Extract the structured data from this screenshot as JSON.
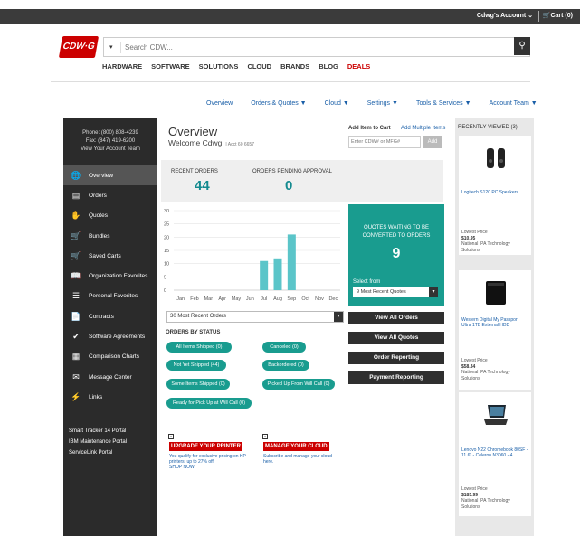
{
  "topbar": {
    "account": "Cdwg's Account",
    "cart": "Cart (0)"
  },
  "header": {
    "logo": "CDW·G",
    "search_placeholder": "Search CDW...",
    "nav": [
      "HARDWARE",
      "SOFTWARE",
      "SOLUTIONS",
      "CLOUD",
      "BRANDS",
      "BLOG"
    ],
    "nav_deals": "DEALS"
  },
  "subnav": [
    "Overview",
    "Orders & Quotes ▼",
    "Cloud ▼",
    "Settings ▼",
    "Tools & Services ▼",
    "Account Team ▼"
  ],
  "sidebar": {
    "phone": "Phone: (800) 808-4239",
    "fax": "Fax: (847) 419-6200",
    "team": "View Your Account Team",
    "items": [
      {
        "label": "Overview",
        "icon": "globe-icon",
        "glyph": "🌐"
      },
      {
        "label": "Orders",
        "icon": "box-icon",
        "glyph": "▤"
      },
      {
        "label": "Quotes",
        "icon": "handshake-icon",
        "glyph": "✋"
      },
      {
        "label": "Bundles",
        "icon": "cart-icon",
        "glyph": "🛒"
      },
      {
        "label": "Saved Carts",
        "icon": "saved-cart-icon",
        "glyph": "🛒"
      },
      {
        "label": "Organization Favorites",
        "icon": "book-icon",
        "glyph": "📖"
      },
      {
        "label": "Personal Favorites",
        "icon": "list-icon",
        "glyph": "☰"
      },
      {
        "label": "Contracts",
        "icon": "document-icon",
        "glyph": "📄"
      },
      {
        "label": "Software Agreements",
        "icon": "check-circle-icon",
        "glyph": "✔"
      },
      {
        "label": "Comparison Charts",
        "icon": "chart-icon",
        "glyph": "▦"
      },
      {
        "label": "Message Center",
        "icon": "message-icon",
        "glyph": "✉"
      },
      {
        "label": "Links",
        "icon": "bolt-icon",
        "glyph": "⚡"
      }
    ],
    "portals": [
      "Smart Tracker 14 Portal",
      "IBM Maintenance Portal",
      "ServiceLink Portal"
    ]
  },
  "main": {
    "title": "Overview",
    "welcome": "Welcome Cdwg",
    "acct": "Acct 60 6657",
    "add_item_title": "Add Item to Cart",
    "add_multiple": "Add Multiple Items",
    "add_placeholder": "Enter CDW# or MFG#",
    "add_button": "Add",
    "recent_orders_label": "RECENT ORDERS",
    "recent_orders_value": "44",
    "pending_label": "ORDERS PENDING APPROVAL",
    "pending_value": "0",
    "recent_select": "30 Most Recent Orders",
    "status_title": "ORDERS BY STATUS",
    "status_left": [
      "All Items Shipped (0)",
      "Not Yet Shipped (44)",
      "Some Items Shipped (0)",
      "Ready for Pick Up at Will Call (0)"
    ],
    "status_right": [
      "Canceled (0)",
      "Backordered (0)",
      "Picked Up From Will Call (0)"
    ],
    "buttons": [
      "View All Orders",
      "View All Quotes",
      "Order Reporting",
      "Payment Reporting"
    ]
  },
  "quotes": {
    "title_line1": "QUOTES WAITING TO BE",
    "title_line2": "CONVERTED TO ORDERS",
    "count": "9",
    "select_from": "Select from",
    "select_value": "9 Most Recent Quotes"
  },
  "chart_data": {
    "type": "bar",
    "categories": [
      "Jan",
      "Feb",
      "Mar",
      "Apr",
      "May",
      "Jun",
      "Jul",
      "Aug",
      "Sep",
      "Oct",
      "Nov",
      "Dec"
    ],
    "values": [
      0,
      0,
      0,
      0,
      0,
      0,
      11,
      12,
      21,
      0,
      0,
      0
    ],
    "ylim": [
      0,
      30
    ],
    "yticks": [
      0,
      5,
      10,
      15,
      20,
      25,
      30
    ],
    "grid": true,
    "color": "#5bc5c9"
  },
  "promos": [
    {
      "title": "UPGRADE YOUR PRINTER",
      "text": "You qualify for exclusive pricing on HP printers, up to 27% off.",
      "link": "SHOP NOW"
    },
    {
      "title": "MANAGE YOUR CLOUD",
      "text": "Subscribe and manage your cloud here.",
      "link": ""
    }
  ],
  "recently_viewed": {
    "title": "RECENTLY VIEWED (3)",
    "items": [
      {
        "name": "Logitech S120 PC Speakers",
        "label": "Lowest Price",
        "price": "$10.95",
        "seller": "National IPA Technology Solutions"
      },
      {
        "name": "Western Digital My Passport Ultra 1TB External HDD",
        "label": "Lowest Price",
        "price": "$58.34",
        "seller": "National IPA Technology Solutions"
      },
      {
        "name": "Lenovo N22 Chromebook 80SF - 11.6\" - Celeron N3060 - 4",
        "label": "Lowest Price",
        "price": "$185.99",
        "seller": "National IPA Technology Solutions"
      }
    ]
  }
}
